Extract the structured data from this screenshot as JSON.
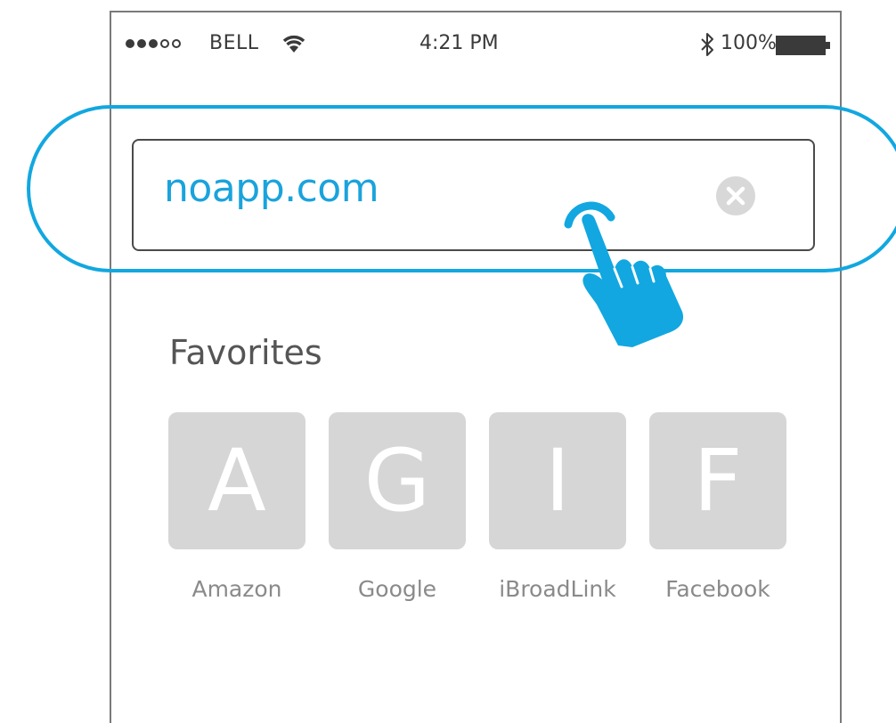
{
  "status_bar": {
    "carrier": "BELL",
    "time": "4:21 PM",
    "battery_percent": "100%",
    "signal_bars_filled": 3,
    "signal_bars_total": 5,
    "battery_level": 1.0
  },
  "address_bar": {
    "value": "noapp.com",
    "clear_icon": "clear-icon"
  },
  "favorites": {
    "title": "Favorites",
    "items": [
      {
        "letter": "A",
        "label": "Amazon"
      },
      {
        "letter": "G",
        "label": "Google"
      },
      {
        "letter": "I",
        "label": "iBroadLink"
      },
      {
        "letter": "F",
        "label": "Facebook"
      }
    ]
  },
  "colors": {
    "accent": "#12a7e0",
    "url_text": "#1aa3dc",
    "tile_bg": "#d6d6d6",
    "tile_letter": "#ffffff"
  },
  "icons": {
    "wifi": "wifi-icon",
    "bluetooth": "bluetooth-icon",
    "battery": "battery-icon",
    "tap_gesture": "tap-hand-icon"
  }
}
